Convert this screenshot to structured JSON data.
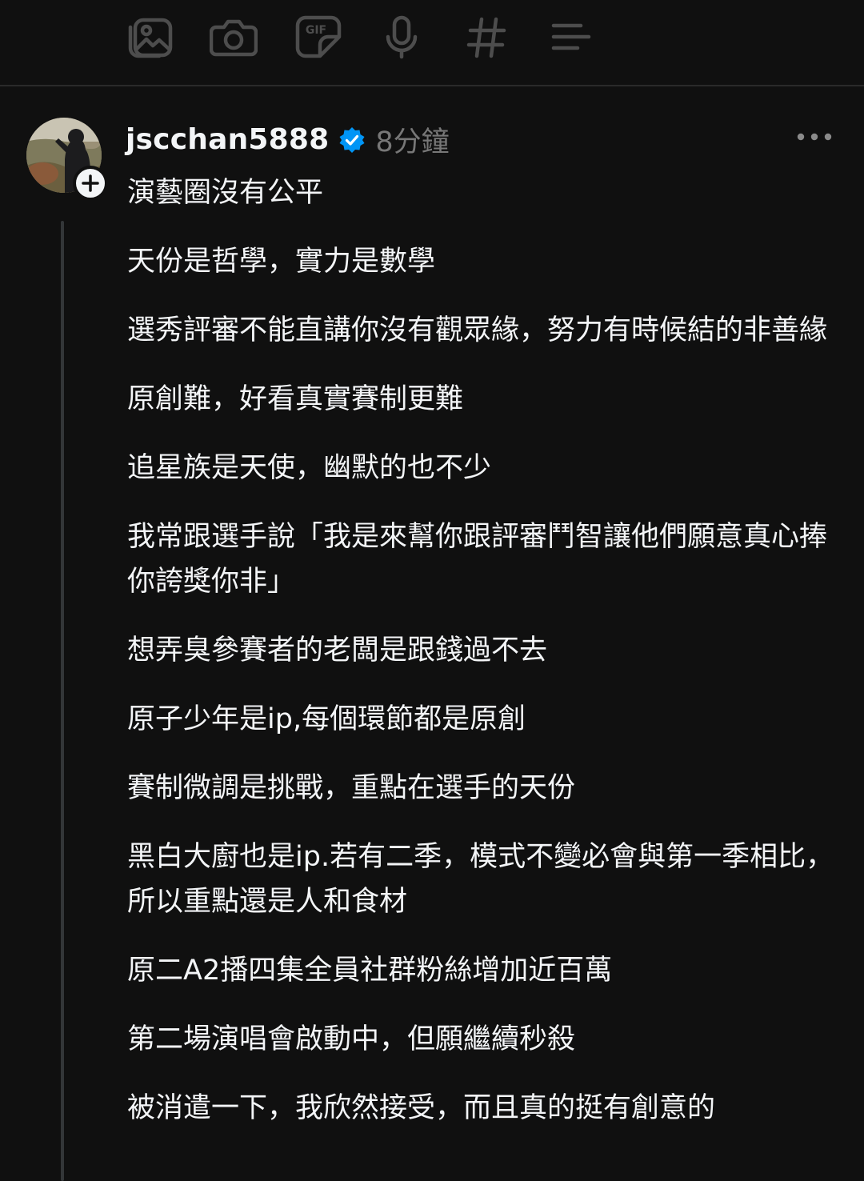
{
  "toolbar": {
    "icons": [
      "gallery-icon",
      "camera-icon",
      "gif-icon",
      "microphone-icon",
      "hashtag-icon",
      "poll-icon"
    ],
    "gif_label": "GIF"
  },
  "post": {
    "username": "jscchan5888",
    "verified": true,
    "timestamp": "8分鐘",
    "paragraphs": [
      "演藝圈沒有公平",
      "天份是哲學，實力是數學",
      "選秀評審不能直講你沒有觀眾緣，努力有時候結的非善緣",
      "原創難，好看真實賽制更難",
      "追星族是天使，幽默的也不少",
      "我常跟選手說「我是來幫你跟評審鬥智讓他們願意真心捧你誇獎你非」",
      "想弄臭參賽者的老闆是跟錢過不去",
      "原子少年是ip,每個環節都是原創",
      "賽制微調是挑戰，重點在選手的天份",
      "黑白大廚也是ip.若有二季，模式不變必會與第一季相比，所以重點還是人和食材",
      "原二A2播四集全員社群粉絲增加近百萬",
      "第二場演唱會啟動中，但願繼續秒殺",
      "被消遣一下，我欣然接受，而且真的挺有創意的"
    ]
  },
  "colors": {
    "background": "#101010",
    "text": "#f3f5f7",
    "muted": "#777777",
    "verified": "#0095f6",
    "icon": "#4d4d4d",
    "thread_line": "#333638"
  }
}
